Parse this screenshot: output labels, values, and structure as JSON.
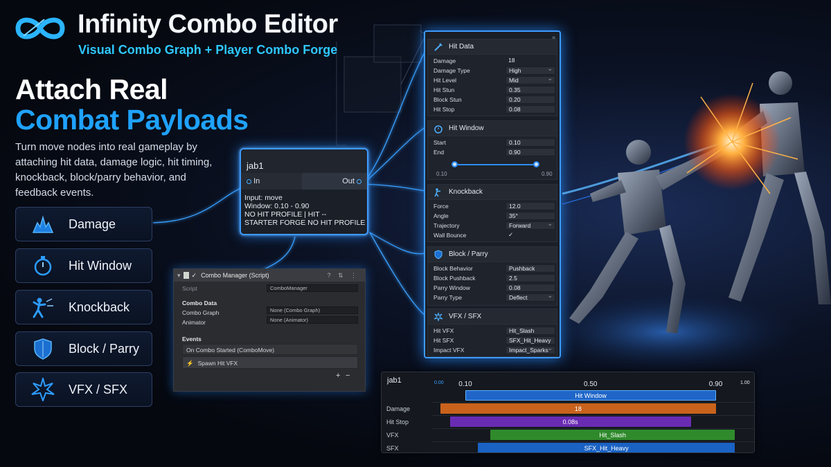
{
  "header": {
    "title": "Infinity Combo Editor",
    "subtitle": "Visual Combo Graph + Player Combo Forge"
  },
  "hero": {
    "headline_line1": "Attach Real",
    "headline_line2": "Combat Payloads",
    "intro": "Turn move nodes into real gameplay by attaching hit data, damage logic, hit timing, knockback, block/parry behavior, and feedback events."
  },
  "features": [
    {
      "label": "Damage",
      "icon": "impact-burst-icon"
    },
    {
      "label": "Hit Window",
      "icon": "stopwatch-icon"
    },
    {
      "label": "Knockback",
      "icon": "knockback-figure-icon"
    },
    {
      "label": "Block / Parry",
      "icon": "shield-icon"
    },
    {
      "label": "VFX / SFX",
      "icon": "spark-burst-icon"
    }
  ],
  "node": {
    "title": "jab1",
    "in_label": "In",
    "out_label": "Out",
    "lines": [
      "Input: move",
      "Window: 0.10 - 0.90",
      "NO HIT PROFILE | HIT --",
      "STARTER  FORGE  NO HIT PROFILE  BUFFER"
    ]
  },
  "inspector": {
    "title": "Combo Manager (Script)",
    "script_label": "Script",
    "script_value": "ComboManager",
    "combo_data_header": "Combo Data",
    "combo_graph_label": "Combo Graph",
    "combo_graph_value": "None (Combo Graph)",
    "animator_label": "Animator",
    "animator_value": "None (Animator)",
    "events_header": "Events",
    "event_name": "On Combo Started (ComboMove)",
    "event_action": "Spawn Hit VFX",
    "add": "+",
    "remove": "−"
  },
  "panel": {
    "hit_data": {
      "title": "Hit Data",
      "rows": [
        {
          "label": "Damage",
          "value": "18"
        },
        {
          "label": "Damage Type",
          "value": "High"
        },
        {
          "label": "Hit Level",
          "value": "Mid"
        },
        {
          "label": "Hit Stun",
          "value": "0.35"
        },
        {
          "label": "Block Stun",
          "value": "0.20"
        },
        {
          "label": "Hit Stop",
          "value": "0.08"
        }
      ]
    },
    "hit_window": {
      "title": "Hit Window",
      "rows": [
        {
          "label": "Start",
          "value": "0.10"
        },
        {
          "label": "End",
          "value": "0.90"
        }
      ],
      "slider_min_label": "0.10",
      "slider_max_label": "0.90",
      "slider_start": 0.1,
      "slider_end": 0.9
    },
    "knockback": {
      "title": "Knockback",
      "rows": [
        {
          "label": "Force",
          "value": "12.0"
        },
        {
          "label": "Angle",
          "value": "35°"
        },
        {
          "label": "Trajectory",
          "value": "Forward"
        },
        {
          "label": "Wall Bounce",
          "value": "✓"
        }
      ]
    },
    "block_parry": {
      "title": "Block / Parry",
      "rows": [
        {
          "label": "Block Behavior",
          "value": "Pushback"
        },
        {
          "label": "Block Pushback",
          "value": "2.5"
        },
        {
          "label": "Parry Window",
          "value": "0.08"
        },
        {
          "label": "Parry Type",
          "value": "Deflect"
        }
      ]
    },
    "vfx_sfx": {
      "title": "VFX / SFX",
      "rows": [
        {
          "label": "Hit VFX",
          "value": "Hit_Slash"
        },
        {
          "label": "Hit SFX",
          "value": "SFX_Hit_Heavy"
        },
        {
          "label": "Impact VFX",
          "value": "Impact_Sparks"
        }
      ]
    }
  },
  "timeline": {
    "title": "jab1",
    "ticks": [
      {
        "label": "0.00",
        "t": 0.0
      },
      {
        "label": "0.10",
        "t": 0.1
      },
      {
        "label": "0.50",
        "t": 0.5
      },
      {
        "label": "0.90",
        "t": 0.9
      },
      {
        "label": "1.00",
        "t": 1.0
      }
    ],
    "tracks": [
      {
        "label": "",
        "bar_text": "Hit Window",
        "start": 0.1,
        "end": 0.9,
        "color": "#1f66c8"
      },
      {
        "label": "Damage",
        "bar_text": "18",
        "start": 0.02,
        "end": 0.9,
        "color": "#c8621c"
      },
      {
        "label": "Hit Stop",
        "bar_text": "0.08s",
        "start": 0.05,
        "end": 0.82,
        "color": "#6a2bb3"
      },
      {
        "label": "VFX",
        "bar_text": "Hit_Slash",
        "start": 0.18,
        "end": 0.96,
        "color": "#2f8a2c"
      },
      {
        "label": "SFX",
        "bar_text": "SFX_Hit_Heavy",
        "start": 0.14,
        "end": 0.96,
        "color": "#1a62c4"
      }
    ]
  },
  "colors": {
    "accent": "#1fa2ff",
    "glow": "#3d9bff",
    "background": "#05080f"
  }
}
